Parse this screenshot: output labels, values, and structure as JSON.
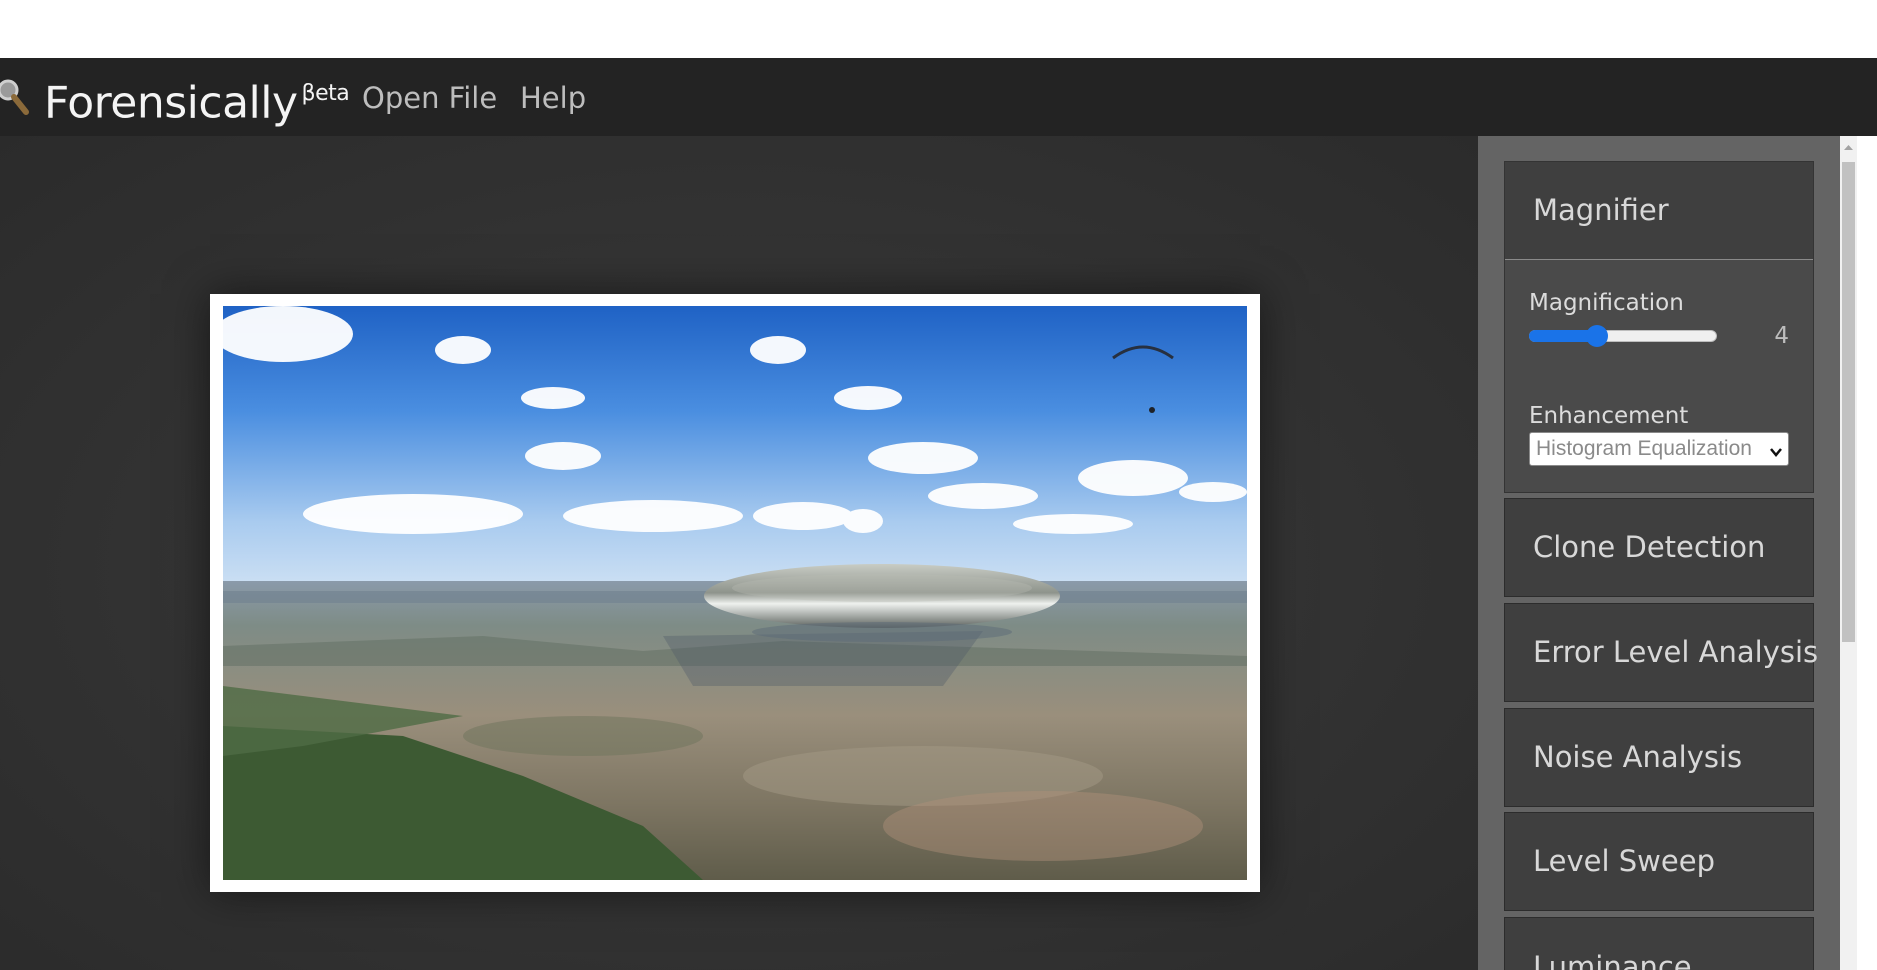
{
  "app": {
    "name": "Forensically",
    "badge": "βeta",
    "nav": [
      {
        "label": "Open File"
      },
      {
        "label": "Help"
      }
    ]
  },
  "magnifier": {
    "title": "Magnifier",
    "magnification_label": "Magnification",
    "magnification_value": "4",
    "magnification_fraction": 0.36,
    "enhancement_label": "Enhancement",
    "enhancement_selected": "Histogram Equalization"
  },
  "tools": [
    {
      "label": "Clone Detection"
    },
    {
      "label": "Error Level Analysis"
    },
    {
      "label": "Noise Analysis"
    },
    {
      "label": "Level Sweep"
    },
    {
      "label": "Luminance"
    }
  ],
  "colors": {
    "navbar": "#232323",
    "workspace": "#343434",
    "sidebar": "#646464",
    "panel": "#3f3f3f",
    "slider_accent": "#1a73e8"
  },
  "icons": [
    "magnifying-glass-icon",
    "chevron-down-icon",
    "scroll-up-arrow-icon"
  ]
}
